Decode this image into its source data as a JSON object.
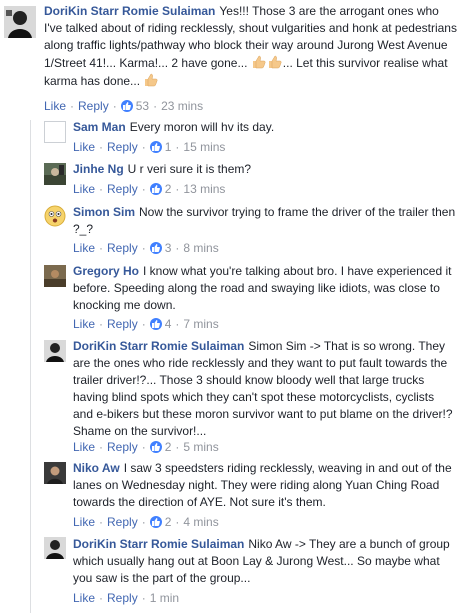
{
  "labels": {
    "like": "Like",
    "reply": "Reply",
    "sep": "·"
  },
  "comments": [
    {
      "author": "DoriKin Starr Romie Sulaiman",
      "text_a": "Yes!!! Those 3 are the arrogant ones who I've talked about of riding recklessly, shout vulgarities and honk at pedestrians along traffic lights/pathway who block their way around Jurong West Avenue 1/Street 41!... Karma!... 2 have gone...",
      "text_b": "... Let this survivor realise what karma has done...",
      "likes": "53",
      "time": "23 mins",
      "emoji": [
        "thumbs-up-emoji",
        "thumbs-up-emoji"
      ]
    },
    {
      "author": "Sam Man",
      "text": "Every moron will hv its day.",
      "likes": "1",
      "time": "15 mins"
    },
    {
      "author": "Jinhe Ng",
      "text": "U r veri sure it is them?",
      "likes": "2",
      "time": "13 mins"
    },
    {
      "author": "Simon Sim",
      "text": "Now the survivor trying to frame the driver of the trailer then ?_?",
      "likes": "3",
      "time": "8 mins"
    },
    {
      "author": "Gregory Ho",
      "text": "I know what you're talking about bro. I have experienced it before. Speeding along the road and swaying like idiots, was close to knocking me down.",
      "likes": "4",
      "time": "7 mins"
    },
    {
      "author": "DoriKin Starr Romie Sulaiman",
      "text": "Simon Sim -> That is so wrong. They are the ones who ride recklessly and they want to put fault towards the trailer driver!?... Those 3 should know bloody well that large trucks having blind spots which they can't spot these motorcyclists, cyclists and e-bikers but these moron survivor want to put blame on the driver!? Shame on the survivor!...",
      "likes": "2",
      "time": "5 mins"
    },
    {
      "author": "Niko Aw",
      "text": "I saw 3 speedsters riding recklessly, weaving in and out of the lanes on Wednesday night. They were riding along Yuan Ching Road towards the direction of AYE. Not sure it's them.",
      "likes": "2",
      "time": "4 mins"
    },
    {
      "author": "DoriKin Starr Romie Sulaiman",
      "text": "Niko Aw -> They are a bunch of group which usually hang out at Boon Lay & Jurong West... So maybe what you saw is the part of the group...",
      "likes": "",
      "time": "1 min"
    }
  ],
  "colors": {
    "name": "#365899",
    "action": "#4267b2",
    "meta": "#90949c",
    "like_badge": "#4080ff"
  }
}
